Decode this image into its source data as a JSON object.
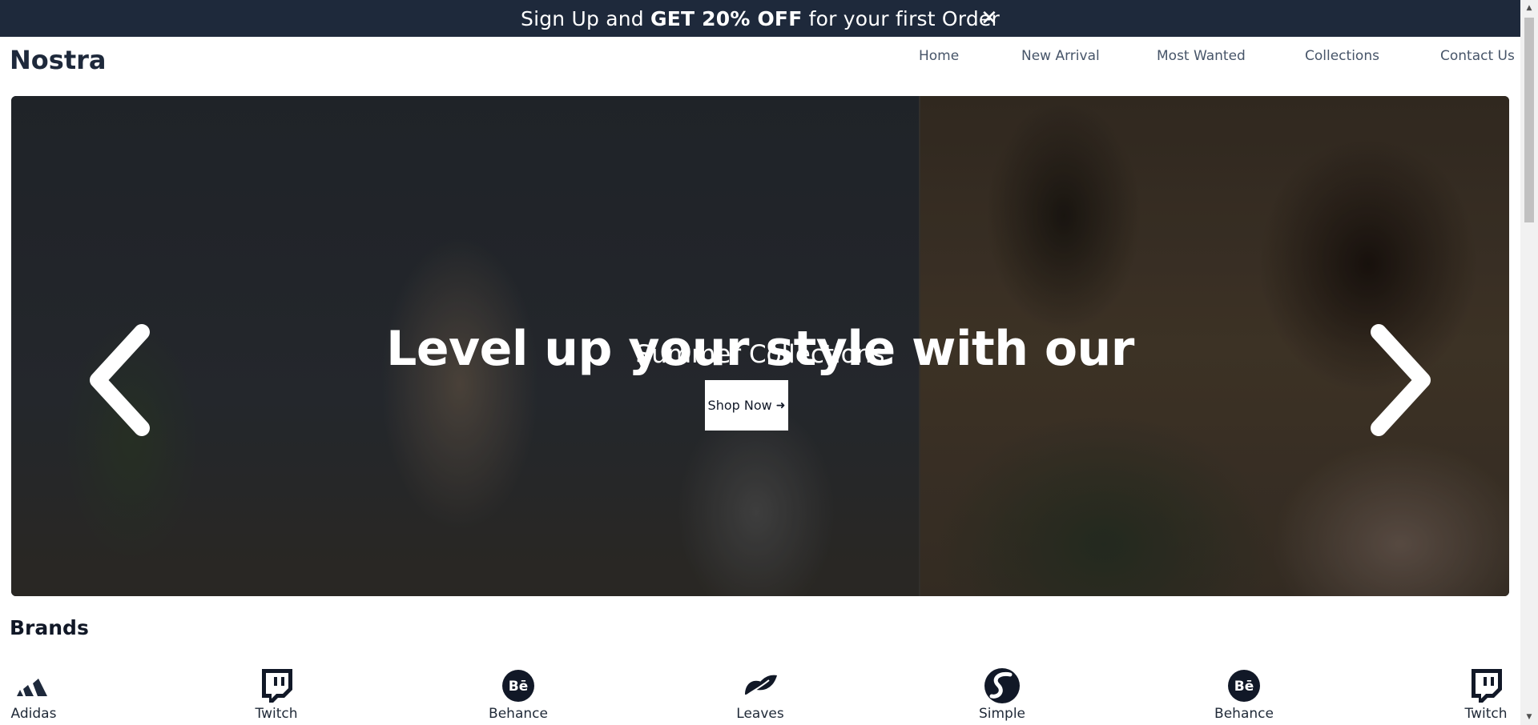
{
  "promo": {
    "text_before": "Sign Up and ",
    "text_bold": "GET 20% OFF",
    "text_after": " for your first Order",
    "close_glyph": "✕"
  },
  "header": {
    "logo": "Nostra",
    "nav": [
      "Home",
      "New Arrival",
      "Most Wanted",
      "Collections",
      "Contact Us"
    ]
  },
  "hero": {
    "title": "Level up your style with our",
    "subtitle": "Summer Collections",
    "cta_label": "Shop Now",
    "cta_arrow": "➜",
    "prev_icon": "chevron-left-icon",
    "next_icon": "chevron-right-icon"
  },
  "brands": {
    "title": "Brands",
    "items": [
      {
        "label": "Adidas",
        "icon": "adidas-icon"
      },
      {
        "label": "Twitch",
        "icon": "twitch-icon"
      },
      {
        "label": "Behance",
        "icon": "behance-icon"
      },
      {
        "label": "Leaves",
        "icon": "leaves-icon"
      },
      {
        "label": "Simple",
        "icon": "simple-icon"
      },
      {
        "label": "Behance",
        "icon": "behance-icon"
      },
      {
        "label": "Twitch",
        "icon": "twitch-icon"
      }
    ]
  },
  "colors": {
    "promo_bg": "#1e293b",
    "text_dark": "#1e293b",
    "nav_text": "#475569"
  }
}
